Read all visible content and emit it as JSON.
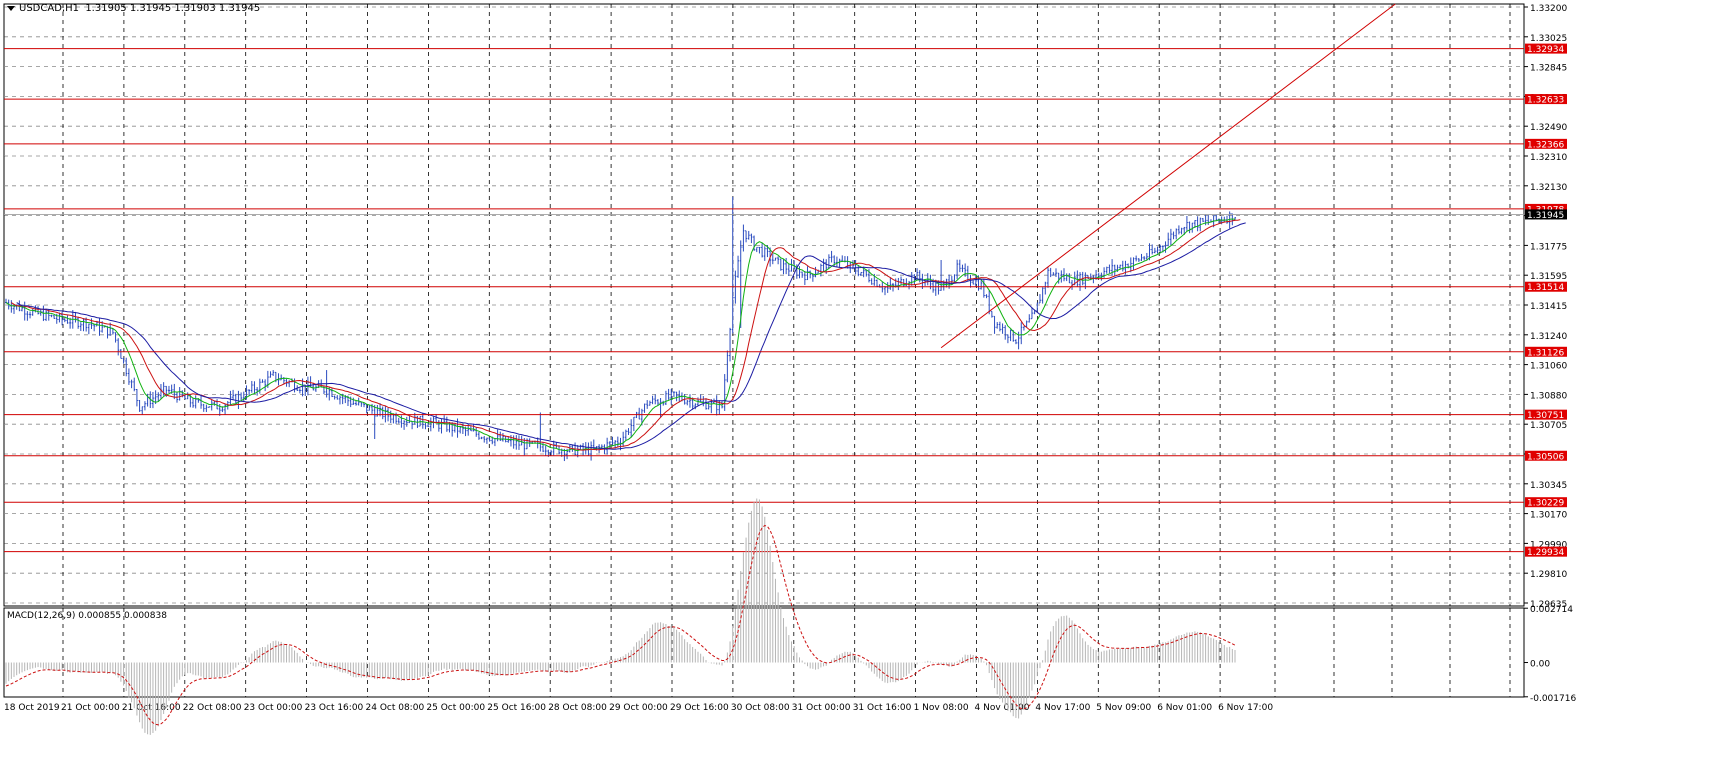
{
  "header": {
    "symbol": "USDCAD,H1",
    "ohlc": "1.31905 1.31945 1.31903 1.31945"
  },
  "macd_header": "MACD(12,26,9) 0.000855 0.000838",
  "colors": {
    "candle": "#2a4bbf",
    "hline": "#d00000",
    "ma_fast": "#11b311",
    "ma_mid": "#cc1111",
    "ma_slow": "#1c1ca3",
    "grid": "#8a8a8a",
    "price_tag_bg": "#e00000",
    "current_tag_bg": "#000000"
  },
  "chart_data": {
    "type": "candlestick",
    "symbol": "USDCAD",
    "timeframe": "H1",
    "price_axis": {
      "range": [
        1.2961,
        1.332
      ],
      "ticks": [
        "1.33200",
        "1.33025",
        "1.32845",
        "1.32665",
        "1.32490",
        "1.32310",
        "1.32130",
        "1.31955",
        "1.31775",
        "1.31595",
        "1.31415",
        "1.31240",
        "1.31060",
        "1.30880",
        "1.30705",
        "1.30525",
        "1.30345",
        "1.30170",
        "1.29990",
        "1.29810",
        "1.29635"
      ]
    },
    "time_axis": {
      "labels": [
        "18 Oct 2019",
        "21 Oct 00:00",
        "21 Oct 16:00",
        "22 Oct 08:00",
        "23 Oct 00:00",
        "23 Oct 16:00",
        "24 Oct 08:00",
        "25 Oct 00:00",
        "25 Oct 16:00",
        "28 Oct 08:00",
        "29 Oct 00:00",
        "29 Oct 16:00",
        "30 Oct 08:00",
        "31 Oct 00:00",
        "31 Oct 16:00",
        "1 Nov 08:00",
        "4 Nov 01:00",
        "4 Nov 17:00",
        "5 Nov 09:00",
        "6 Nov 01:00",
        "6 Nov 17:00"
      ]
    },
    "current_price": "1.31945",
    "horizontal_levels": [
      {
        "label": "1.32934",
        "value": 1.32934
      },
      {
        "label": "1.32633",
        "value": 1.32633
      },
      {
        "label": "1.32366",
        "value": 1.32366
      },
      {
        "label": "1.31978",
        "value": 1.31978
      },
      {
        "label": "1.31514",
        "value": 1.31514
      },
      {
        "label": "1.31126",
        "value": 1.31126
      },
      {
        "label": "1.30751",
        "value": 1.30751
      },
      {
        "label": "1.30506",
        "value": 1.30506
      },
      {
        "label": "1.30229",
        "value": 1.30229
      },
      {
        "label": "1.29934",
        "value": 1.29934
      }
    ],
    "trendline": {
      "from": {
        "bar": 350,
        "price": 1.3115
      },
      "to": {
        "bar": 520,
        "price": 1.332
      }
    },
    "price_path": [
      [
        0,
        1.3142
      ],
      [
        10,
        1.3136
      ],
      [
        20,
        1.3132
      ],
      [
        30,
        1.313
      ],
      [
        40,
        1.3124
      ],
      [
        50,
        1.308
      ],
      [
        60,
        1.309
      ],
      [
        70,
        1.3082
      ],
      [
        80,
        1.308
      ],
      [
        90,
        1.3088
      ],
      [
        100,
        1.3098
      ],
      [
        110,
        1.3092
      ],
      [
        120,
        1.309
      ],
      [
        130,
        1.3082
      ],
      [
        140,
        1.3076
      ],
      [
        150,
        1.3072
      ],
      [
        160,
        1.307
      ],
      [
        170,
        1.3066
      ],
      [
        180,
        1.3062
      ],
      [
        190,
        1.3058
      ],
      [
        200,
        1.3056
      ],
      [
        210,
        1.3054
      ],
      [
        220,
        1.3054
      ],
      [
        230,
        1.306
      ],
      [
        240,
        1.3082
      ],
      [
        250,
        1.3086
      ],
      [
        260,
        1.3082
      ],
      [
        268,
        1.308
      ],
      [
        272,
        1.3145
      ],
      [
        276,
        1.3185
      ],
      [
        280,
        1.3176
      ],
      [
        290,
        1.3164
      ],
      [
        300,
        1.3158
      ],
      [
        310,
        1.3168
      ],
      [
        320,
        1.316
      ],
      [
        330,
        1.315
      ],
      [
        340,
        1.3158
      ],
      [
        350,
        1.315
      ],
      [
        356,
        1.3162
      ],
      [
        365,
        1.3152
      ],
      [
        370,
        1.313
      ],
      [
        378,
        1.312
      ],
      [
        385,
        1.3135
      ],
      [
        390,
        1.316
      ],
      [
        400,
        1.3155
      ],
      [
        410,
        1.316
      ],
      [
        420,
        1.3165
      ],
      [
        430,
        1.3172
      ],
      [
        440,
        1.3188
      ],
      [
        450,
        1.319
      ],
      [
        460,
        1.3194
      ]
    ],
    "macd": {
      "label": "MACD(12,26,9)",
      "main": 0.000855,
      "signal": 0.000838,
      "axis_ticks": [
        "0.002714",
        "0.00",
        "-0.001716"
      ],
      "range": [
        -0.00172,
        0.00272
      ]
    }
  }
}
